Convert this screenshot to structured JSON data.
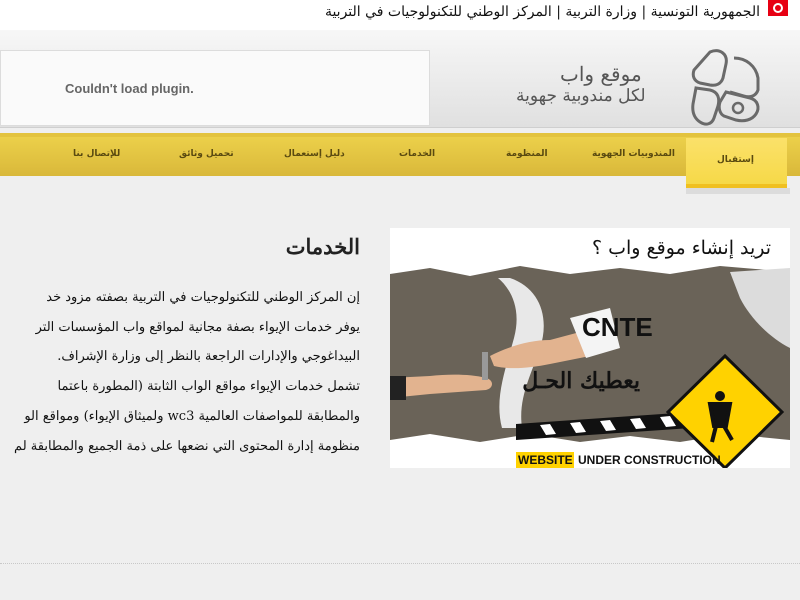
{
  "topbar": {
    "title": "الجمهورية التونسية | وزارة التربية | المركز الوطني للتكنولوجيات في التربية"
  },
  "header": {
    "plugin_message": "Couldn't load plugin.",
    "logo_line1": "موقع واب",
    "logo_line2": "لكل مندوبية جهوية"
  },
  "nav": {
    "items": [
      "إستقبال",
      "المندوبيات الجهوية",
      "المنظومة",
      "الخدمات",
      "دليل إستعمال",
      "تحميل وثائق",
      "للإتصال بنا"
    ],
    "active_index": 0
  },
  "main": {
    "title": "الخدمات",
    "paragraphs": [
      "إن المركز الوطني للتكنولوجيات في التربية بصفته مزود خد",
      "يوفر خدمات الإيواء بصفة مجانية لمواقع واب المؤسسات التر",
      "البيداغوجي والإدارات الراجعة بالنظر إلى وزارة الإشراف.",
      "تشمل خدمات الإيواء مواقع الواب الثابتة (المطورة باعتما",
      "والمطابقة للمواصفات العالمية wc3 ولميثاق الإيواء) ومواقع الو",
      "منظومة إدارة المحتوى التي نضعها على ذمة الجميع والمطابقة لم"
    ]
  },
  "banner": {
    "question": "تريد إنشاء موقع واب ؟",
    "brand": "CNTE",
    "tagline": "يعطيك الحـل",
    "construction_word1": "WEBSITE",
    "construction_word2": "UNDER CONSTRUCTION",
    "colors": {
      "accent": "#f2d44a",
      "sign": "#ffd200",
      "stripe": "#111111"
    }
  },
  "colors": {
    "nav": "#e3c33e",
    "nav_active": "#f9de5c",
    "flag": "#e70013"
  },
  "icons": {
    "flag": "tunisia-flag-icon",
    "logo": "cnte-logo-icon"
  }
}
